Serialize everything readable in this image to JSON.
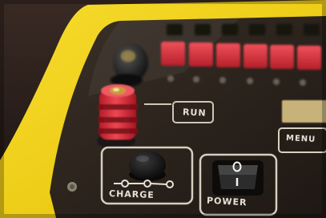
{
  "device": {
    "labels": {
      "run": "RUN",
      "menu": "MENU",
      "charge": "CHARGE",
      "power": "POWER"
    },
    "colors": {
      "case": "#f1d21a",
      "panel": "#2a221b",
      "key": "#d8303a",
      "lcd": "#c7b37a"
    }
  }
}
